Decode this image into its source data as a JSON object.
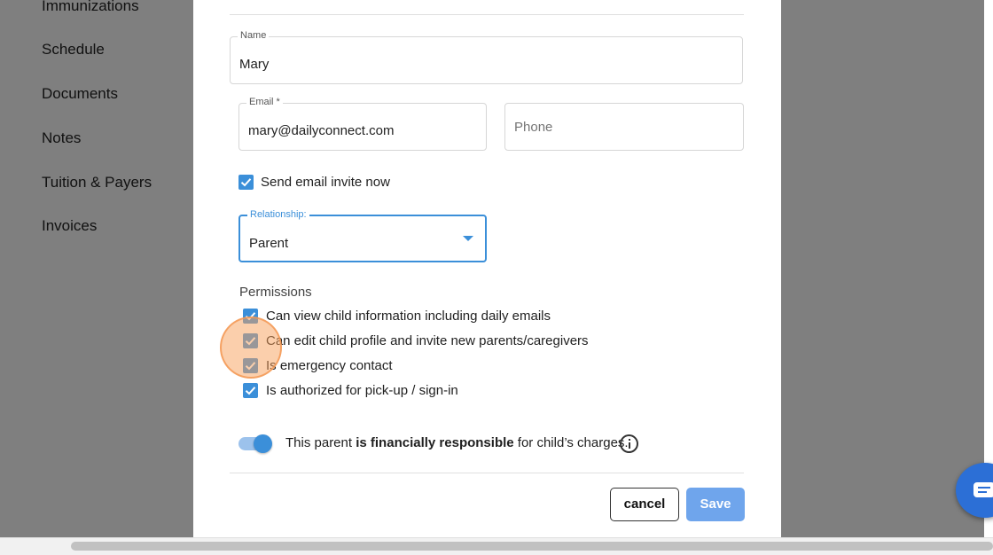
{
  "sidebar": {
    "items": [
      {
        "label": "Immunizations"
      },
      {
        "label": "Schedule"
      },
      {
        "label": "Documents"
      },
      {
        "label": "Notes"
      },
      {
        "label": "Tuition & Payers"
      },
      {
        "label": "Invoices"
      }
    ]
  },
  "form": {
    "name": {
      "label": "Name",
      "value": "Mary"
    },
    "email": {
      "label": "Email *",
      "value": "mary@dailyconnect.com"
    },
    "phone": {
      "placeholder": "Phone"
    },
    "send_invite": {
      "label": "Send email invite now",
      "checked": true
    },
    "relationship": {
      "label": "Relationship:",
      "value": "Parent"
    },
    "permissions": {
      "title": "Permissions",
      "items": [
        {
          "label": "Can view child information including daily emails",
          "checked": true
        },
        {
          "label": "Can edit child profile and invite new parents/caregivers",
          "checked": true
        },
        {
          "label": "Is emergency contact",
          "checked": true
        },
        {
          "label": "Is authorized for pick-up / sign-in",
          "checked": true
        }
      ]
    },
    "financial": {
      "prefix": "This parent",
      "bold": "is financially responsible",
      "suffix": "for child’s charges.",
      "enabled": true
    }
  },
  "actions": {
    "cancel_label": "cancel",
    "save_label": "Save"
  },
  "colors": {
    "accent": "#3b8fd9",
    "save_button": "#6fa5ec",
    "chat_bubble": "#2c6fd6",
    "click_highlight": "#f8a05a"
  },
  "icons": {
    "checkbox": "check-icon",
    "dropdown": "chevron-down-icon",
    "info": "info-icon",
    "chat": "chat-icon"
  }
}
